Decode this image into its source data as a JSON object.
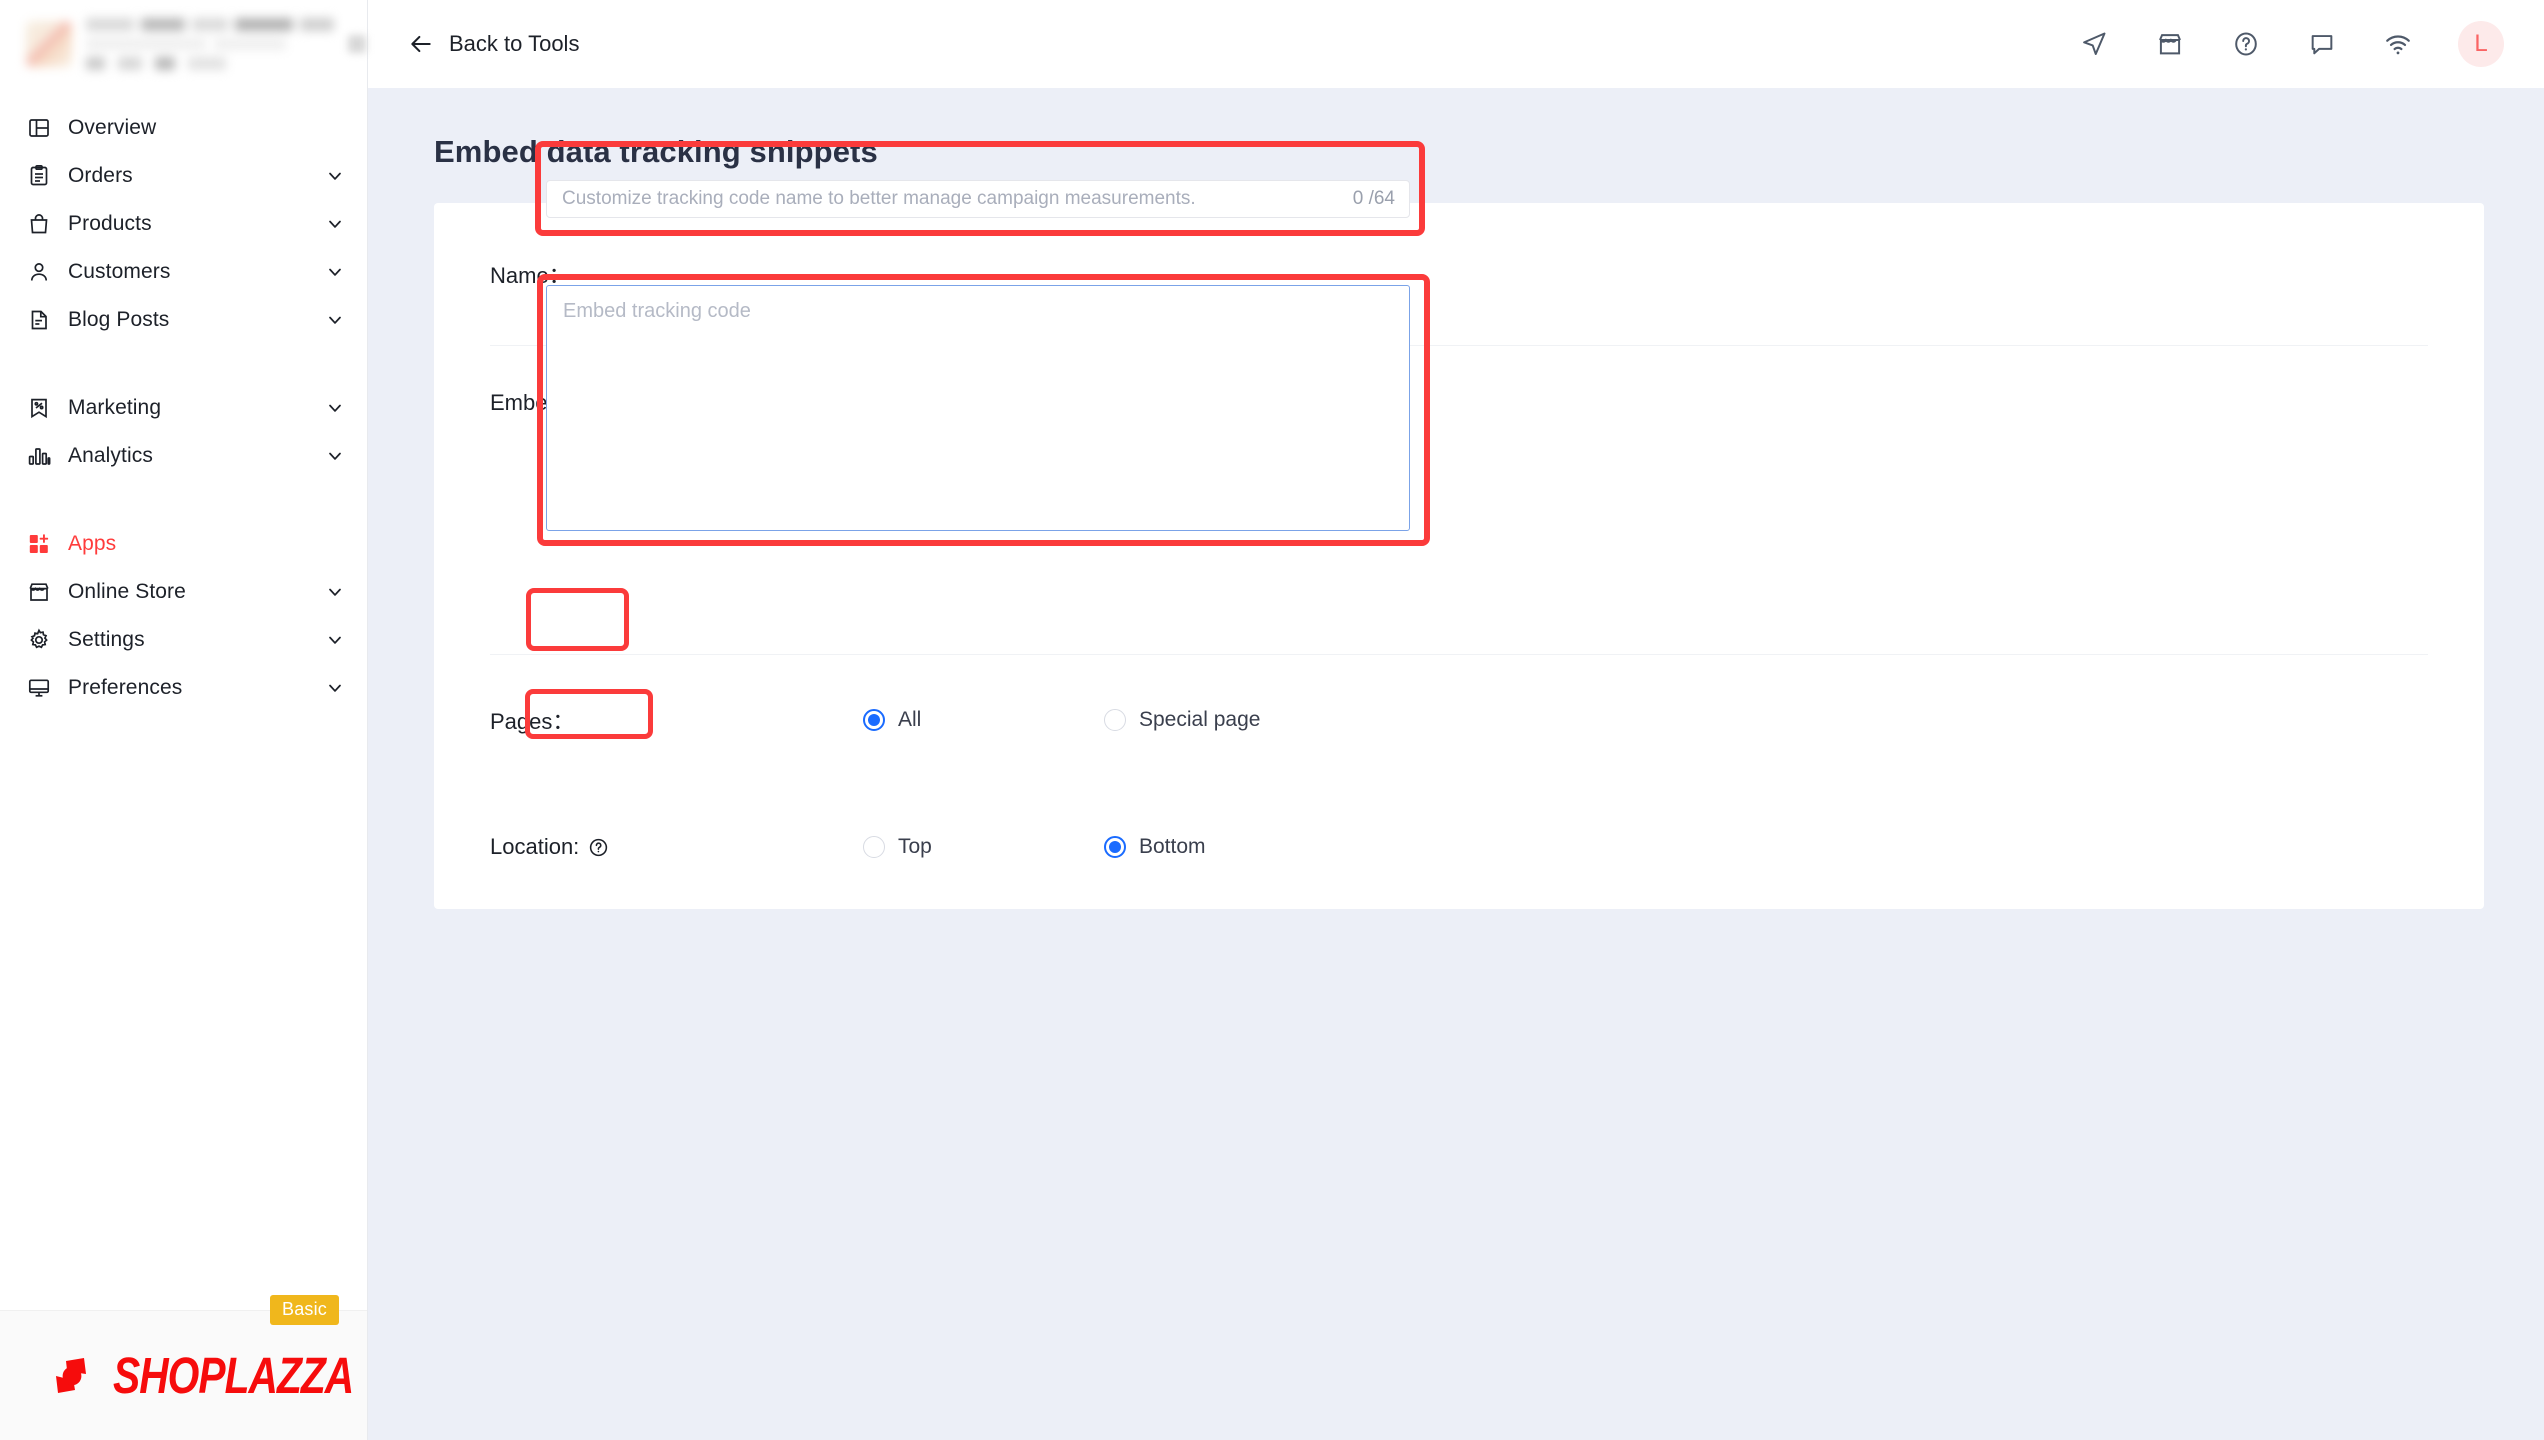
{
  "sidebar": {
    "store_switcher": {
      "name": "store-switcher",
      "redacted": true
    },
    "groups": [
      {
        "items": [
          {
            "label": "Overview",
            "icon": "layout-overview-icon",
            "expandable": false,
            "active": false
          },
          {
            "label": "Orders",
            "icon": "clipboard-orders-icon",
            "expandable": true,
            "active": false
          },
          {
            "label": "Products",
            "icon": "bag-products-icon",
            "expandable": true,
            "active": false
          },
          {
            "label": "Customers",
            "icon": "user-customers-icon",
            "expandable": true,
            "active": false
          },
          {
            "label": "Blog Posts",
            "icon": "document-blog-icon",
            "expandable": true,
            "active": false
          }
        ]
      },
      {
        "items": [
          {
            "label": "Marketing",
            "icon": "tag-marketing-icon",
            "expandable": true,
            "active": false
          },
          {
            "label": "Analytics",
            "icon": "bar-chart-analytics-icon",
            "expandable": true,
            "active": false
          }
        ]
      },
      {
        "items": [
          {
            "label": "Apps",
            "icon": "grid-plus-apps-icon",
            "expandable": false,
            "active": true
          },
          {
            "label": "Online Store",
            "icon": "storefront-icon",
            "expandable": true,
            "active": false
          },
          {
            "label": "Settings",
            "icon": "gear-settings-icon",
            "expandable": true,
            "active": false
          },
          {
            "label": "Preferences",
            "icon": "monitor-preferences-icon",
            "expandable": true,
            "active": false
          }
        ]
      }
    ],
    "brand": {
      "logo_text": "SHOPLAZZA",
      "plan_badge": "Basic"
    }
  },
  "topbar": {
    "back_label": "Back to Tools",
    "back_icon": "arrow-left-icon",
    "icons": [
      {
        "name": "send-navigate-icon"
      },
      {
        "name": "storefront-icon"
      },
      {
        "name": "help-circle-icon"
      },
      {
        "name": "chat-bubble-icon"
      },
      {
        "name": "wifi-icon"
      }
    ],
    "avatar_initial": "L"
  },
  "page": {
    "title": "Embed data tracking snippets"
  },
  "form": {
    "name": {
      "label": "Name：",
      "placeholder": "Customize tracking code name to better manage campaign measurements.",
      "value": "",
      "counter": "0 /64"
    },
    "embed_code": {
      "label": "Embed tracking code：",
      "placeholder": "Embed tracking code",
      "value": ""
    },
    "pages": {
      "label": "Pages：",
      "options": [
        {
          "label": "All",
          "checked": true
        },
        {
          "label": "Special page",
          "checked": false
        }
      ]
    },
    "location": {
      "label": "Location:",
      "help_icon": "help-circle-icon",
      "options": [
        {
          "label": "Top",
          "checked": false
        },
        {
          "label": "Bottom",
          "checked": true
        }
      ]
    }
  },
  "colors": {
    "accent_red": "#ff3b3b",
    "highlight_red": "#fb3b3b",
    "radio_blue": "#1a6bff",
    "page_bg": "#eceff7",
    "badge_yellow": "#f0b71c",
    "logo_red": "#f60c0c"
  },
  "annotations": {
    "highlight_boxes": [
      {
        "target": "name-input"
      },
      {
        "target": "embed-code-textarea"
      },
      {
        "target": "pages-radio-all"
      },
      {
        "target": "location-radio-top"
      }
    ]
  }
}
